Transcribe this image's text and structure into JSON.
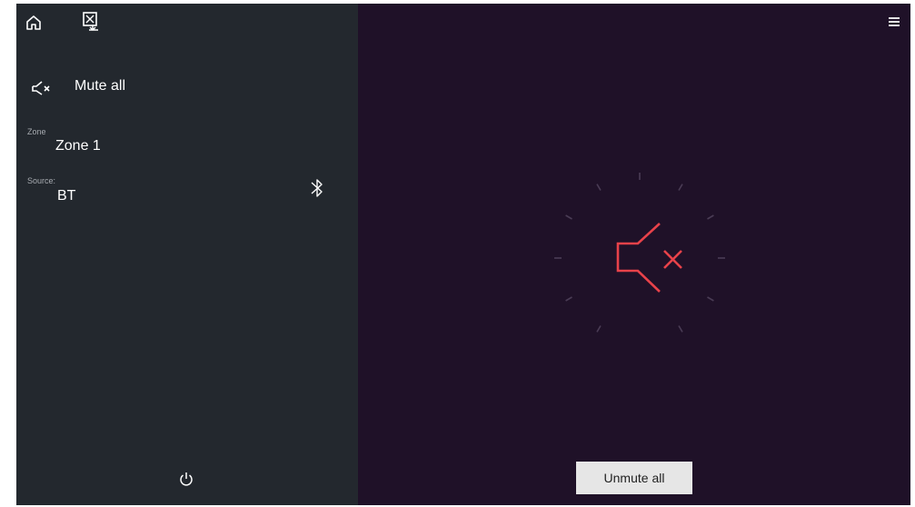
{
  "left_panel": {
    "mute_all_label": "Mute all",
    "zone_label": "Zone",
    "zone_value": "Zone 1",
    "source_label": "Source:",
    "source_value": "BT"
  },
  "right_panel": {
    "unmute_all_label": "Unmute all"
  },
  "colors": {
    "left_panel_bg": "#23282e",
    "right_panel_bg": "#1f1128",
    "mute_symbol": "#e8424a"
  }
}
